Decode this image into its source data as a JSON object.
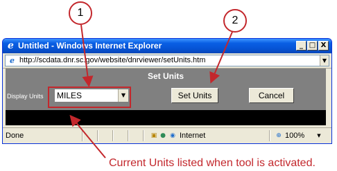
{
  "window": {
    "title": "Untitled - Windows Internet Explorer",
    "address": "http://scdata.dnr.sc.gov/website/dnrviewer/setUnits.htm",
    "controls": {
      "minimize": "_",
      "maximize": "□",
      "close": "X"
    }
  },
  "dialog": {
    "title": "Set Units",
    "display_units_label": "Display Units",
    "units_select_value": "MILES",
    "set_button_label": "Set Units",
    "cancel_button_label": "Cancel"
  },
  "statusbar": {
    "status": "Done",
    "zone": "Internet",
    "zoom": "100%"
  },
  "annotations": {
    "callout_1": "1",
    "callout_2": "2",
    "caption": "Current Units listed when tool is activated.",
    "color": "#c3272c"
  },
  "icons": [
    "ie-logo-icon",
    "page-icon",
    "dropdown-arrow-icon",
    "globe-icon",
    "zoom-icon"
  ]
}
